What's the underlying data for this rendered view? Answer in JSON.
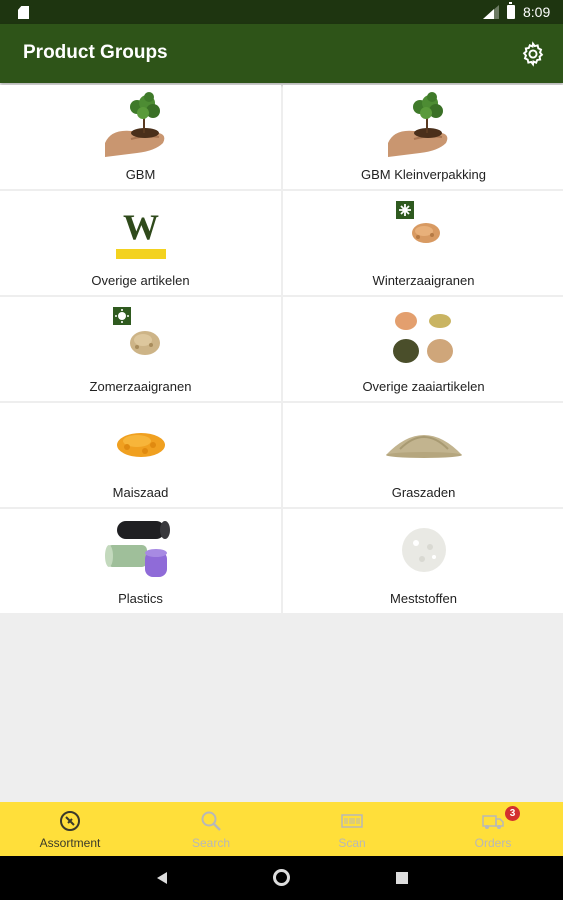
{
  "status_bar": {
    "time": "8:09"
  },
  "app_bar": {
    "title": "Product Groups"
  },
  "groups": [
    {
      "label": "GBM",
      "icon": "plant-in-hand-icon"
    },
    {
      "label": "GBM Kleinverpakking",
      "icon": "plant-in-hand-icon"
    },
    {
      "label": "Overige artikelen",
      "icon": "w-logo-icon",
      "logo_text": "W"
    },
    {
      "label": "Winterzaaigranen",
      "icon": "winter-grain-icon"
    },
    {
      "label": "Zomerzaaigranen",
      "icon": "summer-grain-icon"
    },
    {
      "label": "Overige zaaiartikelen",
      "icon": "mixed-seeds-icon"
    },
    {
      "label": "Maiszaad",
      "icon": "corn-seed-icon"
    },
    {
      "label": "Graszaden",
      "icon": "grass-seed-icon"
    },
    {
      "label": "Plastics",
      "icon": "plastic-rolls-icon"
    },
    {
      "label": "Meststoffen",
      "icon": "fertilizer-icon"
    }
  ],
  "bottom_nav": {
    "items": [
      {
        "label": "Assortment",
        "icon": "assortment-icon",
        "active": true
      },
      {
        "label": "Search",
        "icon": "search-icon",
        "active": false
      },
      {
        "label": "Scan",
        "icon": "barcode-icon",
        "active": false
      },
      {
        "label": "Orders",
        "icon": "truck-icon",
        "active": false
      }
    ],
    "orders_badge": "3"
  },
  "colors": {
    "status_bar": "#1e3510",
    "app_bar": "#2e5418",
    "bottom_nav": "#ffdf3a",
    "badge": "#d32f2f",
    "logo_bar": "#f3d21f"
  }
}
